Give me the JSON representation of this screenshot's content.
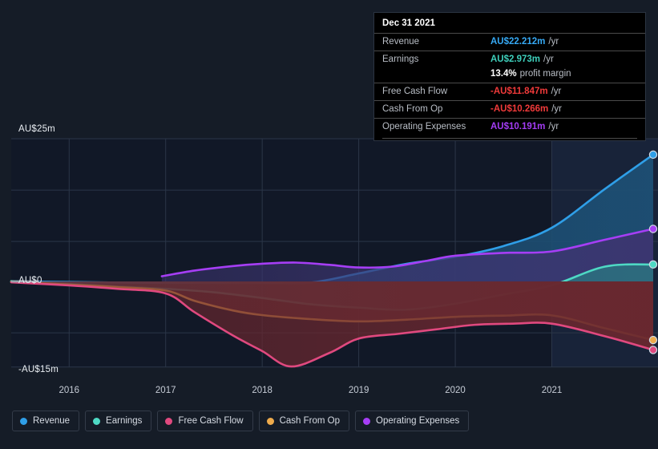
{
  "tooltip": {
    "date": "Dec 31 2021",
    "rows": [
      {
        "key": "Revenue",
        "value": "AU$22.212m",
        "unit": "/yr",
        "color": "#36a9f4"
      },
      {
        "key": "Earnings",
        "value": "AU$2.973m",
        "unit": "/yr",
        "color": "#3ecfbb"
      },
      {
        "key": "Free Cash Flow",
        "value": "-AU$11.847m",
        "unit": "/yr",
        "color": "#f03a3a"
      },
      {
        "key": "Cash From Op",
        "value": "-AU$10.266m",
        "unit": "/yr",
        "color": "#f03a3a"
      },
      {
        "key": "Operating Expenses",
        "value": "AU$10.191m",
        "unit": "/yr",
        "color": "#a43cf5"
      }
    ],
    "margin_value": "13.4%",
    "margin_label": "profit margin"
  },
  "legend": {
    "items": [
      {
        "label": "Revenue",
        "color": "#2f9fe8"
      },
      {
        "label": "Earnings",
        "color": "#4ed9c4"
      },
      {
        "label": "Free Cash Flow",
        "color": "#e0497f"
      },
      {
        "label": "Cash From Op",
        "color": "#eeab4c"
      },
      {
        "label": "Operating Expenses",
        "color": "#a63ef5"
      }
    ]
  },
  "chart_data": {
    "type": "area",
    "title": "",
    "xlabel": "",
    "ylabel": "",
    "ylim": [
      -15,
      25
    ],
    "grid": true,
    "legend_position": "bottom",
    "y_ticks": [
      {
        "label": "AU$25m",
        "value": 25
      },
      {
        "label": "AU$0",
        "value": 0
      },
      {
        "label": "-AU$15m",
        "value": -15
      }
    ],
    "x_ticks": [
      "2016",
      "2017",
      "2018",
      "2019",
      "2020",
      "2021"
    ],
    "x_domain": [
      "2015.4",
      "2022.1"
    ],
    "forecast_start": "2021.0",
    "series": [
      {
        "name": "Revenue",
        "color": "#2f9fe8",
        "fill": "#1d4f74",
        "points": [
          [
            2015.4,
            0.0
          ],
          [
            2016.0,
            -0.1
          ],
          [
            2016.5,
            -0.2
          ],
          [
            2017.0,
            -0.25
          ],
          [
            2017.5,
            -0.25
          ],
          [
            2018.0,
            -0.25
          ],
          [
            2018.5,
            -0.2
          ],
          [
            2019.0,
            1.4
          ],
          [
            2019.5,
            3.1
          ],
          [
            2020.0,
            4.3
          ],
          [
            2020.5,
            6.2
          ],
          [
            2021.0,
            9.4
          ],
          [
            2021.55,
            16.2
          ],
          [
            2022.05,
            22.21
          ]
        ]
      },
      {
        "name": "Earnings",
        "color": "#4ed9c4",
        "fill": "#2c6d7e",
        "points": [
          [
            2015.4,
            0.05
          ],
          [
            2016.0,
            -0.45
          ],
          [
            2016.5,
            -0.9
          ],
          [
            2017.0,
            -1.3
          ],
          [
            2017.5,
            -1.9
          ],
          [
            2018.0,
            -2.9
          ],
          [
            2018.5,
            -4.0
          ],
          [
            2019.0,
            -4.6
          ],
          [
            2019.5,
            -4.95
          ],
          [
            2020.0,
            -3.9
          ],
          [
            2020.5,
            -2.3
          ],
          [
            2021.0,
            -0.7
          ],
          [
            2021.55,
            2.6
          ],
          [
            2022.05,
            2.97
          ]
        ]
      },
      {
        "name": "Operating Expenses",
        "color": "#a63ef5",
        "fill": "#3c3570",
        "points": [
          [
            2016.96,
            0.9
          ],
          [
            2017.3,
            1.9
          ],
          [
            2017.7,
            2.7
          ],
          [
            2018.0,
            3.1
          ],
          [
            2018.35,
            3.3
          ],
          [
            2018.7,
            2.9
          ],
          [
            2019.0,
            2.45
          ],
          [
            2019.35,
            2.6
          ],
          [
            2019.7,
            3.6
          ],
          [
            2020.0,
            4.5
          ],
          [
            2020.5,
            5.0
          ],
          [
            2021.0,
            5.25
          ],
          [
            2021.55,
            7.3
          ],
          [
            2022.05,
            9.2
          ]
        ]
      },
      {
        "name": "Cash From Op",
        "color": "#eeab4c",
        "fill": "#6a2f34",
        "points": [
          [
            2015.4,
            -0.1
          ],
          [
            2016.0,
            -0.55
          ],
          [
            2016.5,
            -1.0
          ],
          [
            2017.0,
            -1.6
          ],
          [
            2017.3,
            -3.4
          ],
          [
            2017.7,
            -5.1
          ],
          [
            2018.0,
            -5.9
          ],
          [
            2018.5,
            -6.6
          ],
          [
            2019.0,
            -7.0
          ],
          [
            2019.5,
            -6.7
          ],
          [
            2020.0,
            -6.2
          ],
          [
            2020.5,
            -6.0
          ],
          [
            2021.0,
            -5.95
          ],
          [
            2021.55,
            -8.2
          ],
          [
            2022.05,
            -10.27
          ]
        ]
      },
      {
        "name": "Free Cash Flow",
        "color": "#e0497f",
        "fill": "#68272f",
        "points": [
          [
            2015.4,
            -0.15
          ],
          [
            2016.0,
            -0.7
          ],
          [
            2016.5,
            -1.3
          ],
          [
            2017.0,
            -2.1
          ],
          [
            2017.3,
            -5.4
          ],
          [
            2017.7,
            -9.5
          ],
          [
            2018.0,
            -12.2
          ],
          [
            2018.3,
            -14.9
          ],
          [
            2018.7,
            -12.5
          ],
          [
            2019.0,
            -10.0
          ],
          [
            2019.4,
            -9.2
          ],
          [
            2019.8,
            -8.4
          ],
          [
            2020.2,
            -7.6
          ],
          [
            2020.6,
            -7.4
          ],
          [
            2021.0,
            -7.4
          ],
          [
            2021.55,
            -9.6
          ],
          [
            2022.05,
            -12.0
          ]
        ]
      }
    ]
  }
}
